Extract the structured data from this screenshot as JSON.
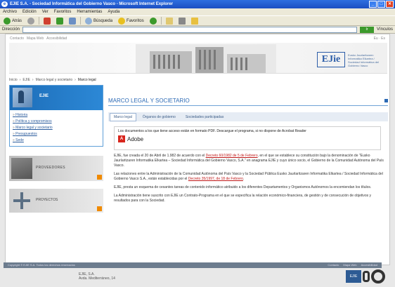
{
  "window": {
    "title": "EJIE S.A. - Sociedad Informática del Gobierno Vasco - Microsoft Internet Explorer",
    "minimize": "_",
    "maximize": "□",
    "close": "✕"
  },
  "menu": [
    "Archivo",
    "Edición",
    "Ver",
    "Favoritos",
    "Herramientas",
    "Ayuda"
  ],
  "toolbar": {
    "back": "Atrás",
    "search": "Búsqueda",
    "favorites": "Favoritos"
  },
  "addressbar": {
    "label": "Dirección",
    "go": "Ir",
    "links": "Vínculos"
  },
  "site": {
    "utilnav": [
      "Contacto",
      "Mapa Web",
      "Accesibilidad"
    ],
    "logo": "EJie",
    "logo_text": "Eusko Jaurlaritzaren Informatika Elkartea / Sociedad Informática del Gobierno Vasco",
    "breadcrumb": [
      "Inicio",
      "EJIE",
      "Marco legal y societario",
      "Marco legal"
    ],
    "sidebar": {
      "eit_label": "EJIE",
      "links": [
        "Historia",
        "Política y compromisos",
        "Marco legal y societario",
        "Presupuestos",
        "Sede"
      ],
      "promo1": "PROVEEDORES",
      "promo2": "PROYECTOS"
    },
    "main": {
      "title": "MARCO LEGAL Y SOCIETARIO",
      "tabs": [
        "Marco legal",
        "Órganos de gobierno",
        "Sociedades participadas"
      ],
      "notice": "Los documentos a los que tiene acceso están en formato PDF. Descargue el programa, si no dispone de Acrobat Reader",
      "adobe": "Adobe",
      "paragraphs": [
        {
          "text": "EJIE, fue creada el 20 de Abril de 1.982 de acuerdo con el",
          "link": "Decreto 60/1982 de 5 de Febrero",
          "tail": ", en el que se establece su constitución bajo la denominación de \"Eusko Jaurlaritzaren Informatika Elkartea – Sociedad Informática del Gobierno Vasco, S.A.\" en anagrama EJIE y cuyo único socio, el Gobierno de la Comunidad Autónoma del País Vasco."
        },
        {
          "text": "Las relaciones entre la Administración de la Comunidad Autónoma del País Vasco y la Sociedad Pública Eusko Jaurlaritzaren Informatika Elkartea / Sociedad Informática del Gobierno Vasco S.A., están establecidas por el",
          "link": "Decreto 35/1997, de 18 de Febrero",
          "tail": "."
        },
        {
          "text": "EJIE, presta un esquema de cesantes tareas de contenido informático atribuido a los diferentes Departamentos y Organismos Autónomos la encomiendan los títulos.",
          "link": "",
          "tail": ""
        },
        {
          "text": "La Administración tiene suscrito con EJIE un Contrato-Programa en el que se especifica la relación económico-financiera, de gestión y de consecución de objetivos y resultados para con la Sociedad.",
          "link": "",
          "tail": ""
        }
      ]
    },
    "footer": {
      "copyright": "Copyright © EJIE S.A. Todos los derechos reservados",
      "links": [
        "Contacto",
        "Mapa Web",
        "Accesibilidad"
      ]
    },
    "below": [
      "EJIE, S.A.",
      "Avda. Mediterráneo, 14"
    ],
    "badge": "EJIE"
  }
}
